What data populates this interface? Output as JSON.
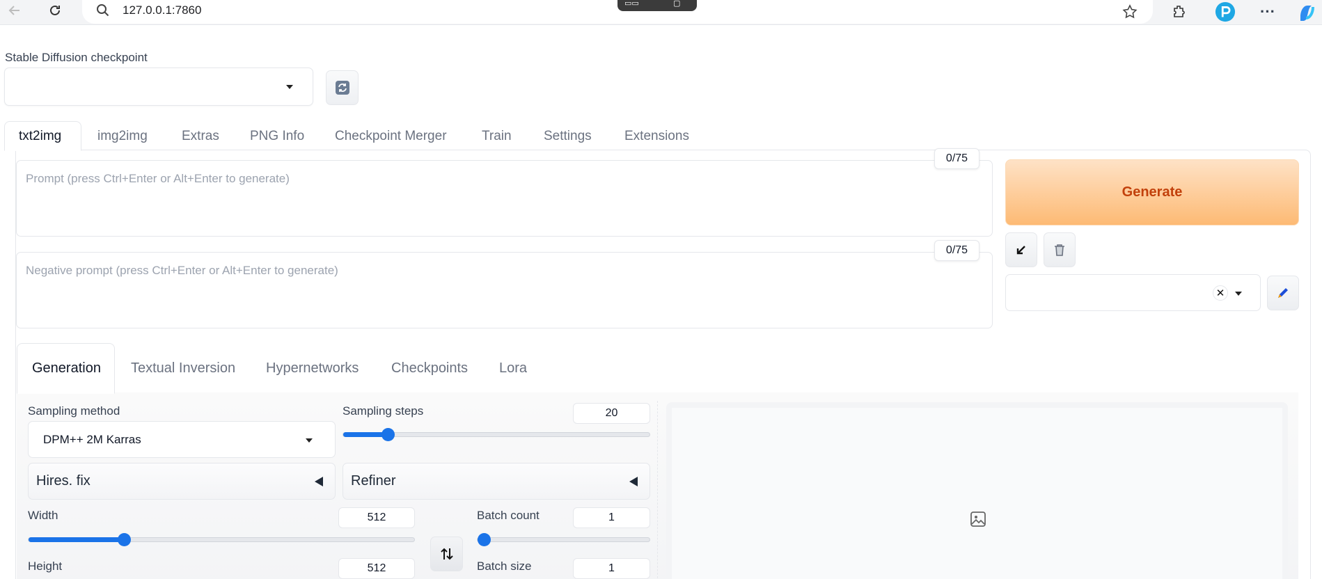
{
  "browser": {
    "url": "127.0.0.1:7860",
    "icons": [
      "back-arrow-icon",
      "reload-icon",
      "search-icon",
      "star-icon",
      "extensions-icon",
      "profile-icon",
      "more-icon",
      "copilot-icon"
    ],
    "more_label": "···"
  },
  "checkpoint": {
    "label": "Stable Diffusion checkpoint",
    "value": ""
  },
  "main_tabs": [
    "txt2img",
    "img2img",
    "Extras",
    "PNG Info",
    "Checkpoint Merger",
    "Train",
    "Settings",
    "Extensions"
  ],
  "prompt": {
    "placeholder": "Prompt (press Ctrl+Enter or Alt+Enter to generate)",
    "token_count": "0/75"
  },
  "negative_prompt": {
    "placeholder": "Negative prompt (press Ctrl+Enter or Alt+Enter to generate)",
    "token_count": "0/75"
  },
  "generate": {
    "label": "Generate",
    "color": "#c2410c"
  },
  "sub_tabs": [
    "Generation",
    "Textual Inversion",
    "Hypernetworks",
    "Checkpoints",
    "Lora"
  ],
  "generation": {
    "sampling_method": {
      "label": "Sampling method",
      "value": "DPM++ 2M Karras"
    },
    "sampling_steps": {
      "label": "Sampling steps",
      "value": "20",
      "fraction": 0.13
    },
    "hires_fix": {
      "label": "Hires. fix"
    },
    "refiner": {
      "label": "Refiner"
    },
    "width": {
      "label": "Width",
      "value": "512",
      "fraction": 0.24
    },
    "height": {
      "label": "Height",
      "value": "512"
    },
    "batch_count": {
      "label": "Batch count",
      "value": "1",
      "fraction": 0.0
    },
    "batch_size": {
      "label": "Batch size",
      "value": "1"
    }
  },
  "accent_color": "#1a73e8"
}
